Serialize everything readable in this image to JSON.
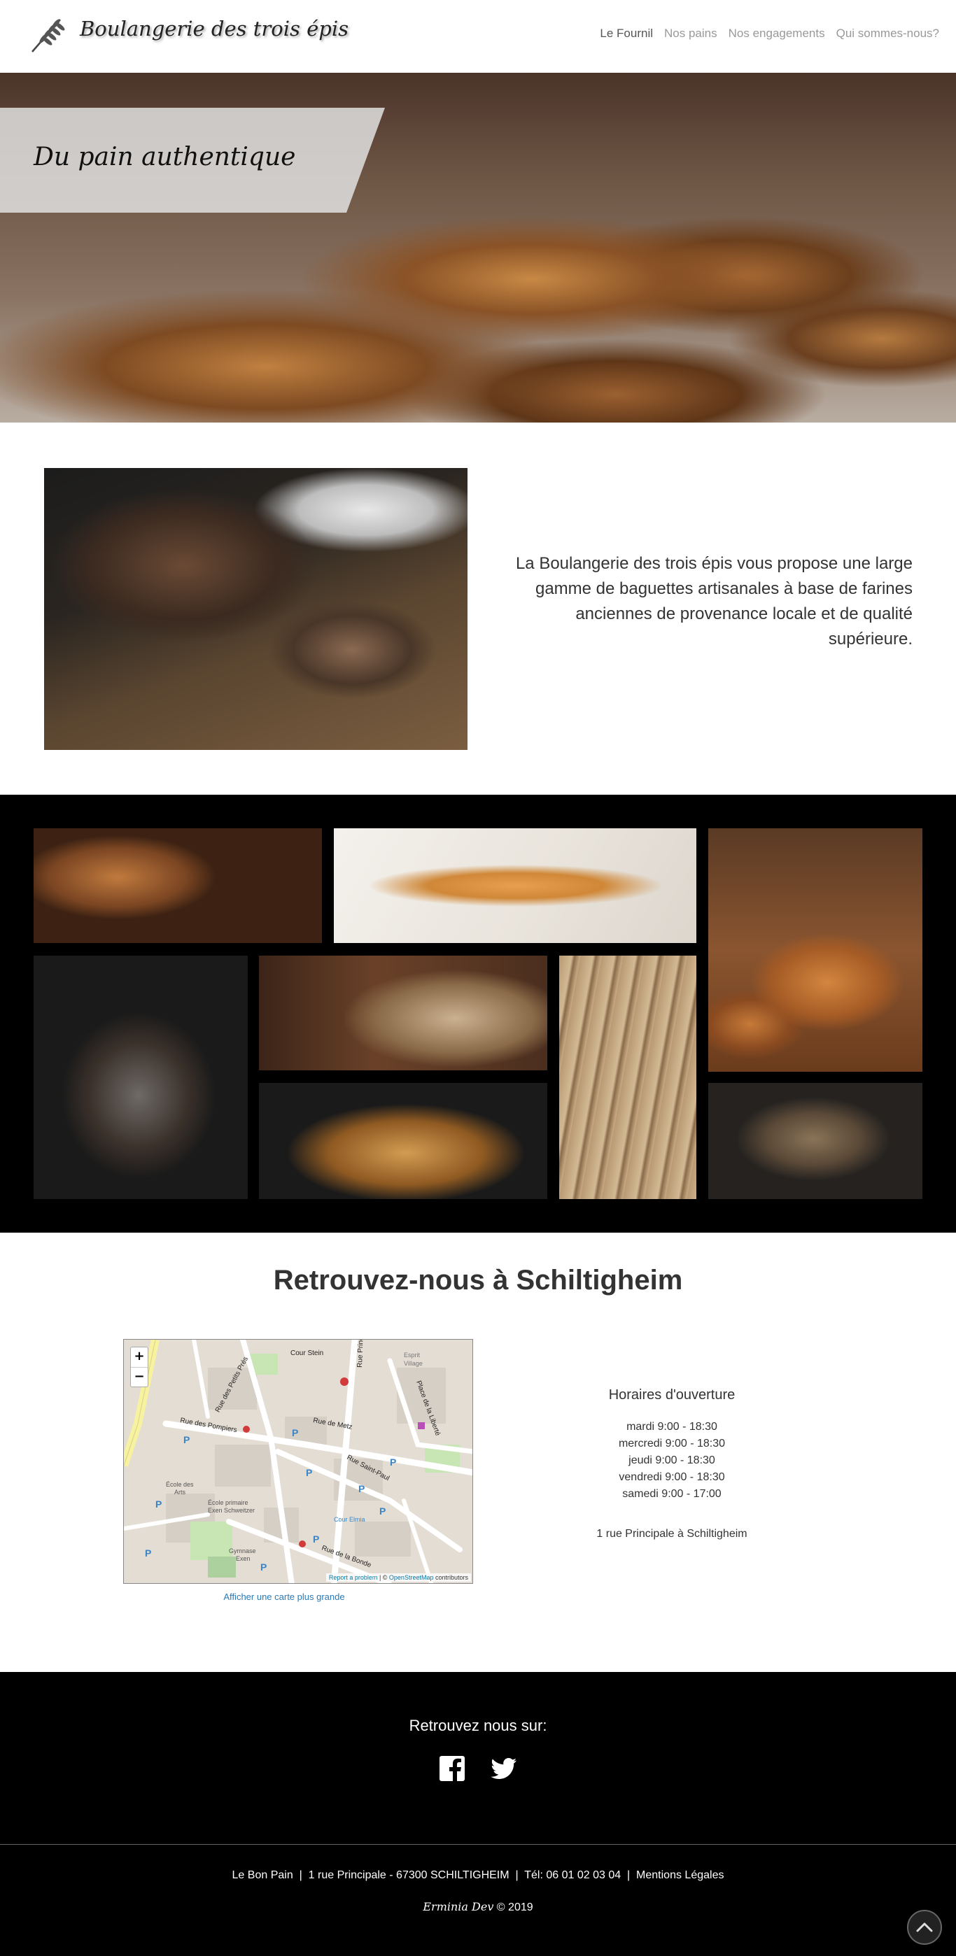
{
  "header": {
    "brand": "Boulangerie des trois épis",
    "logo_icon": "wheat-icon",
    "nav": [
      {
        "label": "Le Fournil",
        "active": true
      },
      {
        "label": "Nos pains",
        "active": false
      },
      {
        "label": "Nos engagements",
        "active": false
      },
      {
        "label": "Qui sommes-nous?",
        "active": false
      }
    ]
  },
  "hero": {
    "title": "Du pain authentique"
  },
  "intro": {
    "text": "La Boulangerie des trois épis vous propose une large gamme de baguettes artisanales à base de farines anciennes de provenance locale et de qualité supérieure."
  },
  "location": {
    "title": "Retrouvez-nous à Schiltigheim",
    "map": {
      "zoom_in": "+",
      "zoom_out": "−",
      "streets": [
        "Rue des Petits Prés",
        "Rue Principale",
        "Rue des Pompiers",
        "Rue de Metz",
        "Rue Saint-Paul",
        "Rue de la Bonde",
        "Cour Elmia",
        "Cour Stein",
        "Place de la Liberté",
        "Esprit Village",
        "École des Arts",
        "École primaire Exen Schweitzer",
        "Gymnase Exen"
      ],
      "report": "Report a problem",
      "attribution_sep": " | © ",
      "osm": "OpenStreetMap",
      "attribution_tail": " contributors"
    },
    "map_link": "Afficher une carte plus grande",
    "hours_title": "Horaires d'ouverture",
    "hours": [
      "mardi 9:00 - 18:30",
      "mercredi 9:00 - 18:30",
      "jeudi 9:00 - 18:30",
      "vendredi 9:00 - 18:30",
      "samedi 9:00 - 17:00"
    ],
    "address": "1 rue Principale à Schiltigheim"
  },
  "footer": {
    "follow": "Retrouvez nous sur:",
    "socials": [
      "facebook-icon",
      "twitter-icon"
    ],
    "info": "Le Bon Pain  |  1 rue Principale - 67300 SCHILTIGHEIM  |  Tél: 06 01 02 03 04  |  Mentions Légales",
    "credit_name": "Erminia Dev",
    "credit_year": " © 2019"
  },
  "colors": {
    "footer_bg": "#000000",
    "link_blue": "#2a7ab8",
    "nav_inactive": "#999999"
  }
}
